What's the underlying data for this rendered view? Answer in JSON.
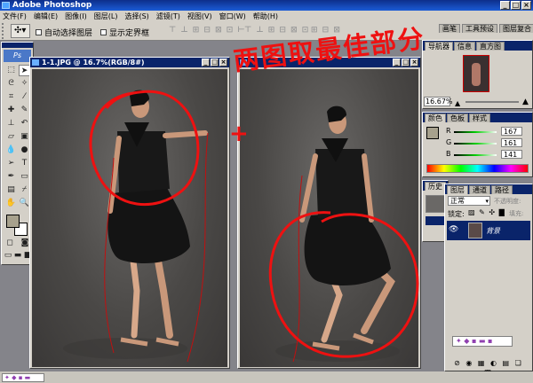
{
  "app": {
    "title": "Adobe Photoshop"
  },
  "menus": [
    "文件(F)",
    "编辑(E)",
    "图像(I)",
    "图层(L)",
    "选择(S)",
    "滤镜(T)",
    "视图(V)",
    "窗口(W)",
    "帮助(H)"
  ],
  "options": {
    "auto_select_label": "自动选择图层",
    "show_bounds_label": "显示定界框",
    "dock_tabs": [
      "画笔",
      "工具预设",
      "图层复合"
    ]
  },
  "documents": [
    {
      "title": "1-1.JPG @ 16.7%(RGB/8#)"
    },
    {
      "title": ""
    }
  ],
  "annotations": {
    "caption": "两图取最佳部分",
    "plus": "+"
  },
  "navigator": {
    "tabs": [
      "导航器",
      "信息",
      "直方图"
    ],
    "zoom": "16.67%"
  },
  "color_panel": {
    "tabs": [
      "颜色",
      "色板",
      "样式"
    ],
    "channels": [
      {
        "label": "R",
        "value": "167",
        "fraction": 0.65
      },
      {
        "label": "G",
        "value": "161",
        "fraction": 0.63
      },
      {
        "label": "B",
        "value": "141",
        "fraction": 0.55
      }
    ]
  },
  "history_panel": {
    "tabs": [
      "历史"
    ]
  },
  "layers_panel": {
    "tabs": [
      "图层",
      "通道",
      "路径"
    ],
    "blend_mode": "正常",
    "opacity_label": "不透明度:",
    "lock_label": "锁定:",
    "fill_label": "填充:",
    "layer_name": "背景"
  },
  "colors": {
    "annotation": "#e11111",
    "titlebar": "#0a246a",
    "fg_swatch": "#a7a18d"
  }
}
